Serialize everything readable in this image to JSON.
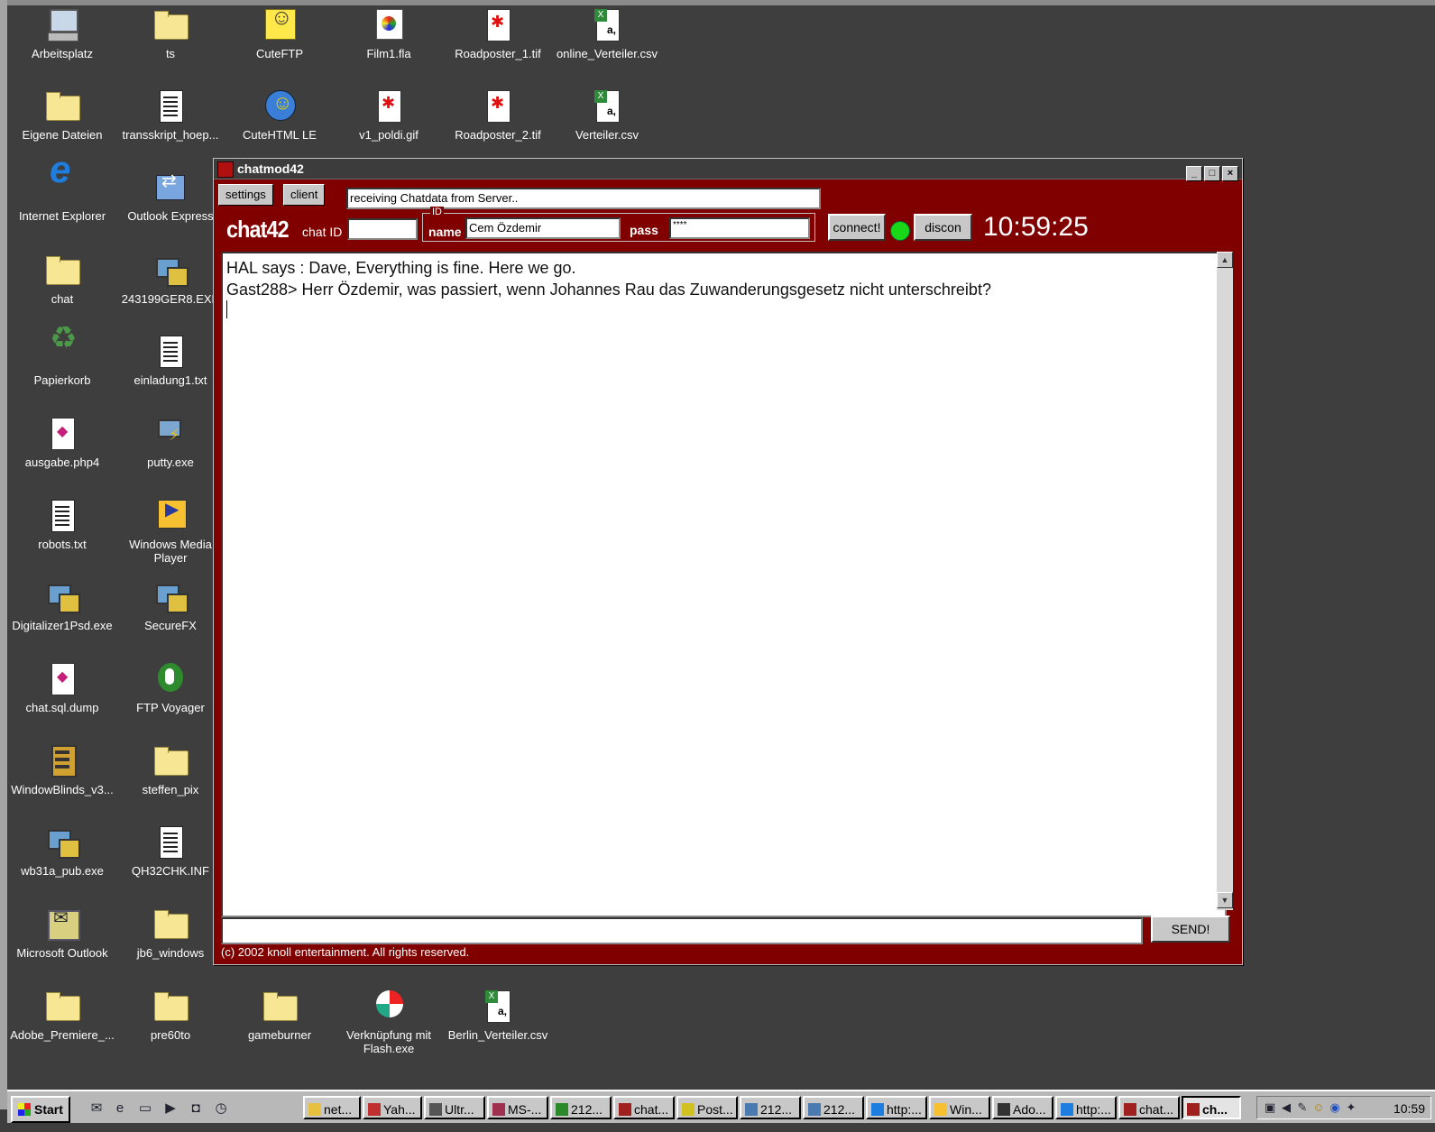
{
  "desktop": {
    "icons": [
      {
        "label": "Arbeitsplatz",
        "icon": "computer-icon"
      },
      {
        "label": "ts",
        "icon": "folder-icon"
      },
      {
        "label": "CuteFTP",
        "icon": "cuteftp-icon"
      },
      {
        "label": "Film1.fla",
        "icon": "flash-file-icon"
      },
      {
        "label": "Roadposter_1.tif",
        "icon": "image-file-icon"
      },
      {
        "label": "online_Verteiler.csv",
        "icon": "excel-file-icon"
      },
      {
        "label": "Eigene Dateien",
        "icon": "folder-icon"
      },
      {
        "label": "transskript_hoep...",
        "icon": "text-file-icon"
      },
      {
        "label": "CuteHTML LE",
        "icon": "cutehtml-icon"
      },
      {
        "label": "v1_poldi.gif",
        "icon": "image-file-icon"
      },
      {
        "label": "Roadposter_2.tif",
        "icon": "image-file-icon"
      },
      {
        "label": "Verteiler.csv",
        "icon": "excel-file-icon"
      },
      {
        "label": "Internet Explorer",
        "icon": "internet-explorer-icon"
      },
      {
        "label": "Outlook Express",
        "icon": "outlook-express-icon"
      },
      {
        "label": "chat",
        "icon": "folder-icon"
      },
      {
        "label": "243199GER8.EXE",
        "icon": "installer-icon"
      },
      {
        "label": "Papierkorb",
        "icon": "recycle-bin-icon"
      },
      {
        "label": "einladung1.txt",
        "icon": "text-file-icon"
      },
      {
        "label": "ausgabe.php4",
        "icon": "php-file-icon"
      },
      {
        "label": "putty.exe",
        "icon": "putty-icon"
      },
      {
        "label": "robots.txt",
        "icon": "text-file-icon"
      },
      {
        "label": "Windows Media Player",
        "icon": "media-player-icon"
      },
      {
        "label": "Digitalizer1Psd.exe",
        "icon": "application-icon"
      },
      {
        "label": "SecureFX",
        "icon": "securefx-icon"
      },
      {
        "label": "chat.sql.dump",
        "icon": "sql-file-icon"
      },
      {
        "label": "FTP Voyager",
        "icon": "ftp-voyager-icon"
      },
      {
        "label": "WindowBlinds_v3...",
        "icon": "windowblinds-icon"
      },
      {
        "label": "steffen_pix",
        "icon": "folder-icon"
      },
      {
        "label": "wb31a_pub.exe",
        "icon": "application-icon"
      },
      {
        "label": "QH32CHK.INF",
        "icon": "inf-file-icon"
      },
      {
        "label": "Microsoft Outlook",
        "icon": "outlook-icon"
      },
      {
        "label": "jb6_windows",
        "icon": "folder-icon"
      },
      {
        "label": "Adobe_Premiere_...",
        "icon": "folder-icon"
      },
      {
        "label": "pre60to",
        "icon": "folder-icon"
      },
      {
        "label": "gameburner",
        "icon": "folder-icon"
      },
      {
        "label": "Verknüpfung mit Flash.exe",
        "icon": "flash-shortcut-icon"
      },
      {
        "label": "Berlin_Verteiler.csv",
        "icon": "excel-file-icon"
      }
    ]
  },
  "window": {
    "title": "chatmod42",
    "controls": {
      "minimize": "_",
      "maximize": "□",
      "close": "×"
    },
    "tabs": [
      {
        "label": "settings"
      },
      {
        "label": "client"
      }
    ],
    "status_text": "receiving Chatdata from Server..",
    "brand": "chat42",
    "chat_id_label": "chat ID",
    "chat_id_value": "",
    "id_group_label": "ID",
    "name_label": "name",
    "name_value": "Cem Özdemir",
    "pass_label": "pass",
    "pass_value": "****",
    "connect_label": "connect!",
    "connection_status_color": "#18d818",
    "discon_label": "discon",
    "clock": "10:59:25",
    "messages": [
      "HAL says : Dave, Everything is fine. Here we go.",
      "Gast288> Herr Özdemir, was passiert, wenn Johannes Rau das Zuwanderungsgesetz nicht unterschreibt?"
    ],
    "message_input_value": "",
    "send_label": "SEND!",
    "footer": "(c) 2002 knoll entertainment. All rights reserved."
  },
  "taskbar": {
    "start_label": "Start",
    "quick_launch": [
      "outlook-express-icon",
      "internet-explorer-icon",
      "desktop-icon",
      "media-player-icon",
      "outlook-icon",
      "clock-icon"
    ],
    "tasks": [
      {
        "label": "net...",
        "active": false
      },
      {
        "label": "Yah...",
        "active": false
      },
      {
        "label": "Ultr...",
        "active": false
      },
      {
        "label": "MS-...",
        "active": false
      },
      {
        "label": "212...",
        "active": false
      },
      {
        "label": "chat...",
        "active": false
      },
      {
        "label": "Post...",
        "active": false
      },
      {
        "label": "212...",
        "active": false
      },
      {
        "label": "212...",
        "active": false
      },
      {
        "label": "http:...",
        "active": false
      },
      {
        "label": "Win...",
        "active": false
      },
      {
        "label": "Ado...",
        "active": false
      },
      {
        "label": "http:...",
        "active": false
      },
      {
        "label": "chat...",
        "active": false
      },
      {
        "label": "ch...",
        "active": true
      }
    ],
    "tray_icons": [
      "tray-monitor-icon",
      "volume-icon",
      "tray-app-icon",
      "tray-smiley-icon",
      "tray-eye-icon",
      "tray-network-icon"
    ],
    "clock": "10:59"
  },
  "colors": {
    "window_background": "#800000",
    "desktop_background": "#3e3e3e",
    "title_bar": "#3c3c3c"
  }
}
